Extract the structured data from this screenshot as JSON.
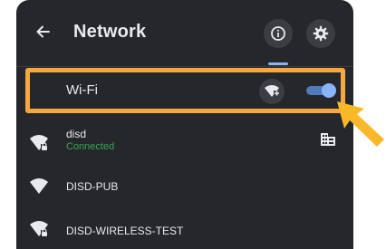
{
  "header": {
    "title": "Network",
    "back_icon": "arrow-left-icon",
    "info_icon": "info-icon",
    "settings_icon": "gear-icon"
  },
  "wifi": {
    "label": "Wi-Fi",
    "enabled": true,
    "add_icon": "wifi-add-icon"
  },
  "networks": [
    {
      "name": "disd",
      "status": "Connected",
      "secured": true,
      "managed": true
    },
    {
      "name": "DISD-PUB",
      "status": "",
      "secured": false,
      "managed": false
    },
    {
      "name": "DISD-WIRELESS-TEST",
      "status": "",
      "secured": true,
      "managed": false
    }
  ],
  "colors": {
    "panel_bg": "#26272b",
    "accent": "#8ab4f8",
    "connected": "#34a853",
    "highlight": "#f5a742"
  }
}
